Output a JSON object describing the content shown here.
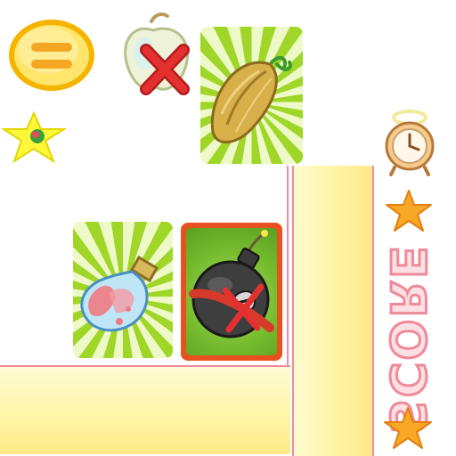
{
  "hud": {
    "score_label": "SCORE"
  },
  "icons": {
    "menu": "pause-menu-icon",
    "apple_disabled": "apple-crossed-icon",
    "star_sticker": "star-sticker-icon",
    "clock": "alarm-clock-icon",
    "star": "star-icon"
  },
  "cards": [
    {
      "item": "seed",
      "state": "available"
    },
    {
      "item": "potion",
      "state": "available"
    },
    {
      "item": "bomb",
      "state": "selected"
    }
  ],
  "colors": {
    "sunburst_light": "#eef9c8",
    "sunburst_dark": "#9fd628",
    "panel_yellow": "#fff3a3",
    "panel_border": "#ef8ca0",
    "accent_orange": "#f5a623",
    "bomb_frame": "#e8501f",
    "cross_red": "#e53030"
  }
}
